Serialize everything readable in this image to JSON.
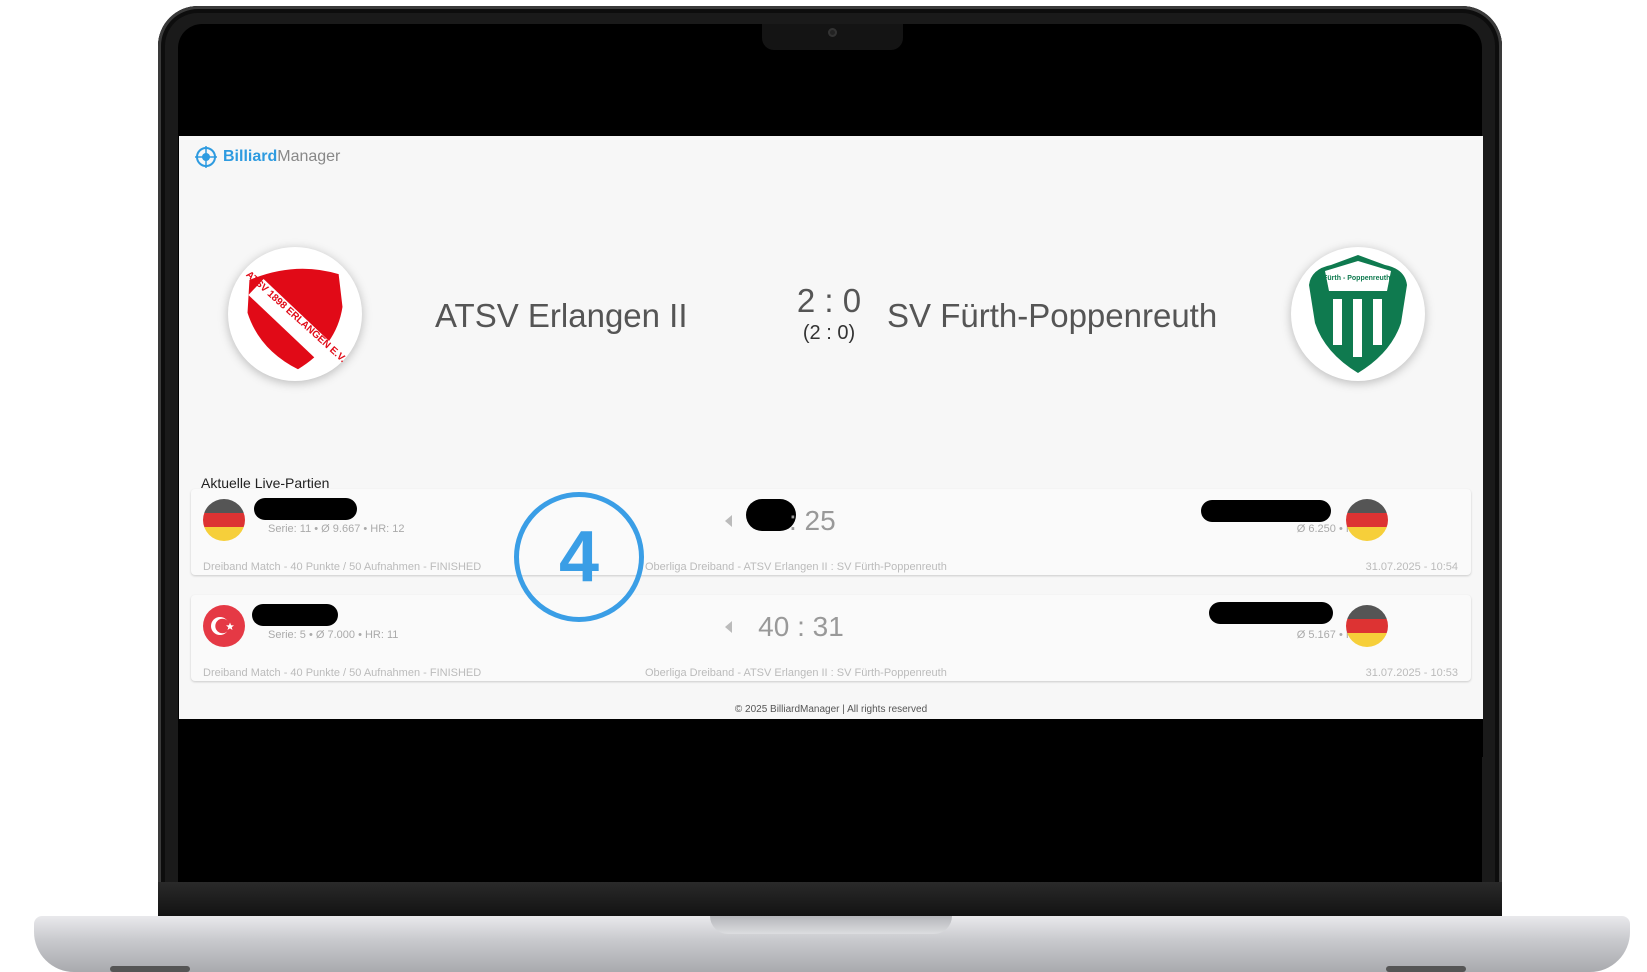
{
  "app": {
    "brand_bold": "Billiard",
    "brand_rest": "Manager"
  },
  "match": {
    "home_team": "ATSV Erlangen II",
    "away_team": "SV Fürth-Poppenreuth",
    "score": "2 : 0",
    "score_sub": "(2 : 0)",
    "home_logo_text": "ATSV 1898 ERLANGEN E.V.",
    "away_logo_text": "SV Fürth - Poppenreuth e.V."
  },
  "live": {
    "title": "Aktuelle Live-Partien",
    "games": [
      {
        "left_flag": "germany-flag",
        "left_stats": "Serie: 11 • Ø 9.667 • HR: 12",
        "score": ": 25",
        "right_flag": "germany-flag",
        "right_stats": "Ø 6.250 • HR: 9",
        "type": "Dreiband Match - 40 Punkte / 50 Aufnahmen - FINISHED",
        "league": "Oberliga Dreiband - ATSV Erlangen II : SV Fürth-Poppenreuth",
        "time": "31.07.2025 - 10:54"
      },
      {
        "left_flag": "turkey-flag",
        "left_stats": "Serie: 5 • Ø 7.000 • HR: 11",
        "score": "40 : 31",
        "right_flag": "germany-flag",
        "right_stats": "Ø 5.167 • HR: 8",
        "type": "Dreiband Match - 40 Punkte / 50 Aufnahmen - FINISHED",
        "league": "Oberliga Dreiband - ATSV Erlangen II : SV Fürth-Poppenreuth",
        "time": "31.07.2025 - 10:53"
      }
    ]
  },
  "footer": "© 2025 BilliardManager | All rights reserved",
  "overlay": {
    "step_number": "4",
    "color": "#3a9ee6"
  },
  "colors": {
    "brand": "#2e9be0",
    "home_red": "#e10a17",
    "away_green": "#0f7a4f"
  }
}
